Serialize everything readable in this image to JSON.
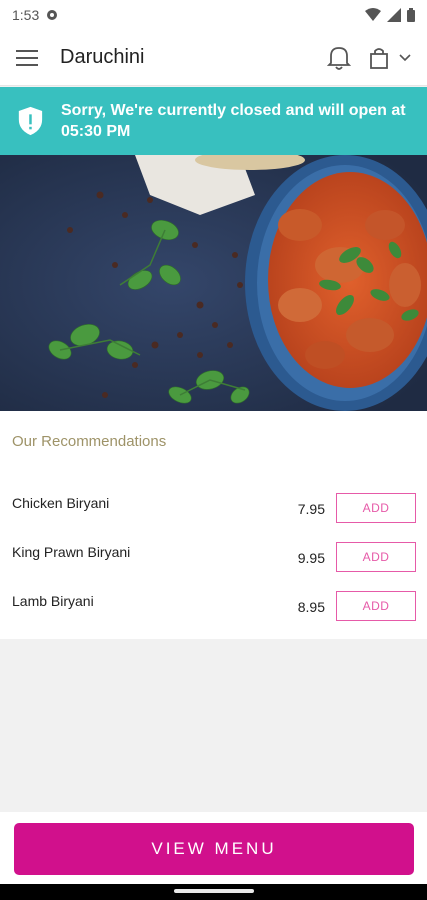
{
  "status_bar": {
    "time": "1:53"
  },
  "app_bar": {
    "title": "Daruchini",
    "menu_icon": "hamburger-icon",
    "bell_icon": "bell-icon",
    "bag_icon": "shopping-bag-icon",
    "dropdown_icon": "chevron-down-icon"
  },
  "banner": {
    "text": "Sorry, We're currently closed and will open at 05:30 PM",
    "icon": "shield-alert-icon",
    "color": "#38c0bf"
  },
  "recommendations": {
    "title": "Our Recommendations",
    "items": [
      {
        "name": "Chicken Biryani",
        "price": "7.95",
        "add_label": "ADD"
      },
      {
        "name": "King Prawn Biryani",
        "price": "9.95",
        "add_label": "ADD"
      },
      {
        "name": "Lamb Biryani",
        "price": "8.95",
        "add_label": "ADD"
      }
    ]
  },
  "footer": {
    "view_menu_label": "VIEW MENU",
    "accent": "#d1108c"
  }
}
